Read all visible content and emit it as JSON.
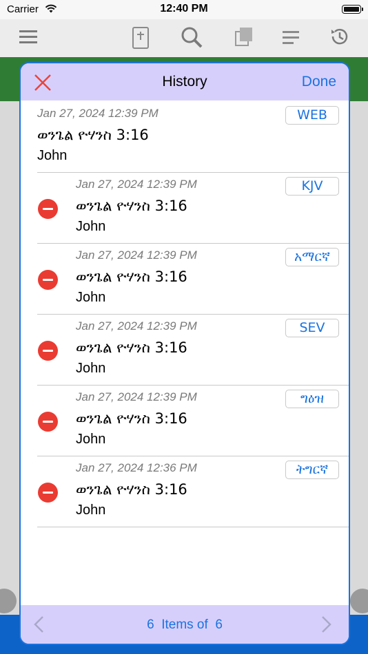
{
  "status": {
    "carrier": "Carrier",
    "time": "12:40 PM"
  },
  "toolbar": {
    "icons": [
      "menu-icon",
      "bible-icon",
      "search-icon",
      "pages-icon",
      "text-lines-icon",
      "history-icon"
    ]
  },
  "modal": {
    "title": "History",
    "done_label": "Done",
    "close_icon": "close-x-icon",
    "items": [
      {
        "date": "Jan 27, 2024 12:39 PM",
        "reference": "ወንጌል ዮሃንስ 3:16",
        "book": "John",
        "version": "WEB",
        "deletable": false
      },
      {
        "date": "Jan 27, 2024 12:39 PM",
        "reference": "ወንጌል ዮሃንስ 3:16",
        "book": "John",
        "version": "KJV",
        "deletable": true
      },
      {
        "date": "Jan 27, 2024 12:39 PM",
        "reference": "ወንጌል ዮሃንስ 3:16",
        "book": "John",
        "version": "አማርኛ",
        "deletable": true
      },
      {
        "date": "Jan 27, 2024 12:39 PM",
        "reference": "ወንጌል ዮሃንስ 3:16",
        "book": "John",
        "version": "SEV",
        "deletable": true
      },
      {
        "date": "Jan 27, 2024 12:39 PM",
        "reference": "ወንጌል ዮሃንስ 3:16",
        "book": "John",
        "version": "ግዕዝ",
        "deletable": true
      },
      {
        "date": "Jan 27, 2024 12:36 PM",
        "reference": "ወንጌል ዮሃንስ 3:16",
        "book": "John",
        "version": "ትግርኛ",
        "deletable": true
      }
    ],
    "footer": {
      "count": "6",
      "items_of": "Items of",
      "total": "6"
    }
  },
  "colors": {
    "accent": "#1a73e0",
    "header_bg": "#d7cffb",
    "delete": "#ea3b32",
    "green_bar": "#2f7d34",
    "bottom_bar": "#0d63c8"
  }
}
